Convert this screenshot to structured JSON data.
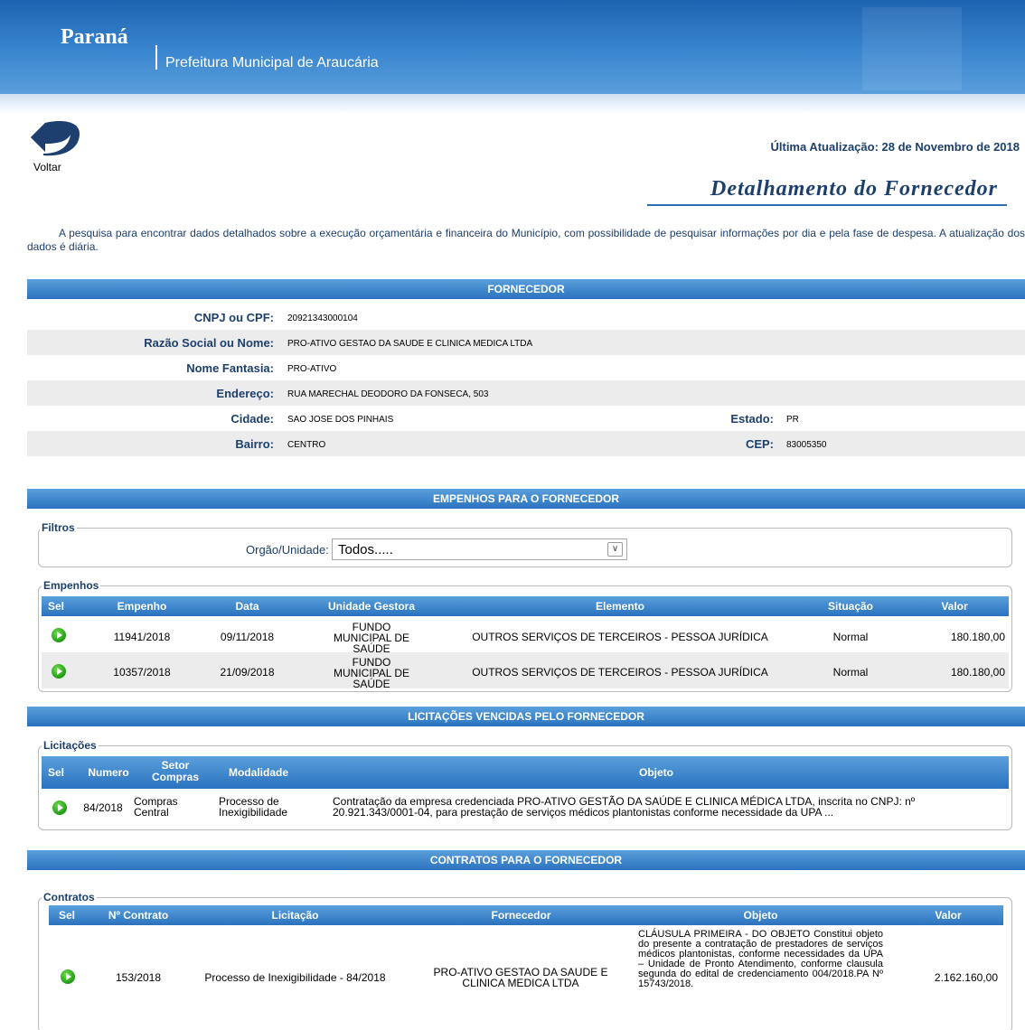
{
  "header": {
    "brand": "Paraná",
    "subtitle": "Prefeitura Municipal de Araucária"
  },
  "back_label": "Voltar",
  "last_update": "Última Atualização: 28 de Novembro de 2018",
  "page_title": "Detalhamento do Fornecedor",
  "intro": "A pesquisa para encontrar dados detalhados sobre a execução orçamentária e financeira do Município, com possibilidade de pesquisar informações por dia e pela fase de despesa. A atualização dos dados é diária.",
  "fornecedor": {
    "title": "FORNECEDOR",
    "cnpj_label": "CNPJ ou CPF:",
    "cnpj": "20921343000104",
    "razao_label": "Razão Social ou Nome:",
    "razao": "PRO-ATIVO GESTAO DA SAUDE E CLINICA MEDICA LTDA",
    "fantasia_label": "Nome Fantasia:",
    "fantasia": "PRO-ATIVO",
    "endereco_label": "Endereço:",
    "endereco": "RUA MARECHAL DEODORO DA FONSECA, 503",
    "cidade_label": "Cidade:",
    "cidade": "SAO JOSE DOS PINHAIS",
    "estado_label": "Estado:",
    "estado": "PR",
    "bairro_label": "Bairro:",
    "bairro": "CENTRO",
    "cep_label": "CEP:",
    "cep": "83005350"
  },
  "empenhos": {
    "title": "EMPENHOS PARA O FORNECEDOR",
    "filtros_legend": "Filtros",
    "orgao_label": "Orgão/Unidade:",
    "orgao_value": "Todos.....",
    "legend": "Empenhos",
    "columns": [
      "Sel",
      "Empenho",
      "Data",
      "Unidade Gestora",
      "Elemento",
      "Situação",
      "Valor"
    ],
    "rows": [
      {
        "empenho": "11941/2018",
        "data": "09/11/2018",
        "unidade": "FUNDO MUNICIPAL DE SAÚDE",
        "elemento": "OUTROS SERVIÇOS DE TERCEIROS - PESSOA JURÍDICA",
        "situacao": "Normal",
        "valor": "180.180,00"
      },
      {
        "empenho": "10357/2018",
        "data": "21/09/2018",
        "unidade": "FUNDO MUNICIPAL DE SAÚDE",
        "elemento": "OUTROS SERVIÇOS DE TERCEIROS - PESSOA JURÍDICA",
        "situacao": "Normal",
        "valor": "180.180,00"
      }
    ]
  },
  "licitacoes": {
    "title": "LICITAÇÕES VENCIDAS PELO FORNECEDOR",
    "legend": "Licitações",
    "columns": [
      "Sel",
      "Numero",
      "Setor Compras",
      "Modalidade",
      "Objeto"
    ],
    "rows": [
      {
        "numero": "84/2018",
        "setor": "Compras Central",
        "modalidade": "Processo de Inexigibilidade",
        "objeto": "Contratação da empresa credenciada PRO-ATIVO GESTÃO DA SAÚDE E CLINICA MÉDICA LTDA, inscrita no CNPJ: nº 20.921.343/0001-04, para prestação de serviços médicos plantonistas conforme necessidade da UPA ..."
      }
    ]
  },
  "contratos": {
    "title": "CONTRATOS PARA O FORNECEDOR",
    "legend": "Contratos",
    "columns": [
      "Sel",
      "Nº Contrato",
      "Licitação",
      "Fornecedor",
      "Objeto",
      "Valor"
    ],
    "rows": [
      {
        "numero": "153/2018",
        "licitacao": "Processo de Inexigibilidade - 84/2018",
        "fornecedor": "PRO-ATIVO GESTAO DA SAUDE E CLINICA MEDICA LTDA",
        "objeto": "CLÁUSULA PRIMEIRA - DO OBJETO Constitui objeto do presente a contratação de prestadores de serviços médicos plantonistas, conforme necessidades da UPA – Unidade de Pronto Atendimento, conforme clausula segunda do edital de credenciamento 004/2018.PA Nº 15743/2018.",
        "valor": "2.162.160,00"
      }
    ]
  }
}
